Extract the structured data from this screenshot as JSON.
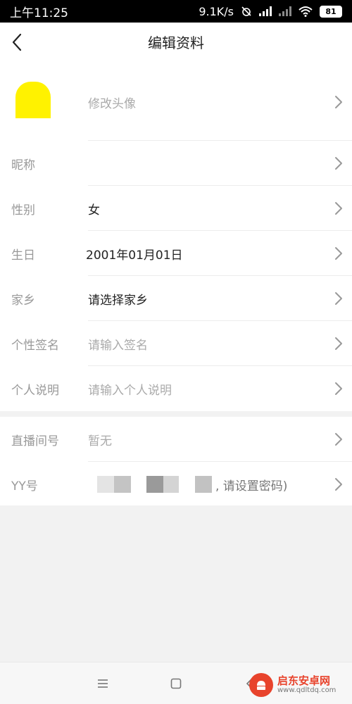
{
  "status_bar": {
    "time": "上午11:25",
    "network_speed": "9.1K/s",
    "battery": "81"
  },
  "header": {
    "title": "编辑资料"
  },
  "avatar_row": {
    "label": "修改头像",
    "avatar_color": "#fff200"
  },
  "profile": {
    "nickname": {
      "label": "昵称",
      "value": ""
    },
    "gender": {
      "label": "性别",
      "value": "女"
    },
    "birthday": {
      "label": "生日",
      "value": "2001年01月01日"
    },
    "hometown": {
      "label": "家乡",
      "value": "请选择家乡"
    },
    "signature": {
      "label": "个性签名",
      "value": "请输入签名"
    },
    "bio": {
      "label": "个人说明",
      "value": "请输入个人说明"
    }
  },
  "account": {
    "room": {
      "label": "直播间号",
      "value": "暂无"
    },
    "yy": {
      "label": "YY号",
      "value": ", 请设置密码)"
    }
  },
  "watermark": {
    "name": "启东安卓网",
    "url": "www.qdltdq.com"
  },
  "colors": {
    "accent_red": "#e8432c",
    "label_gray": "#999999",
    "text_dark": "#222222"
  }
}
